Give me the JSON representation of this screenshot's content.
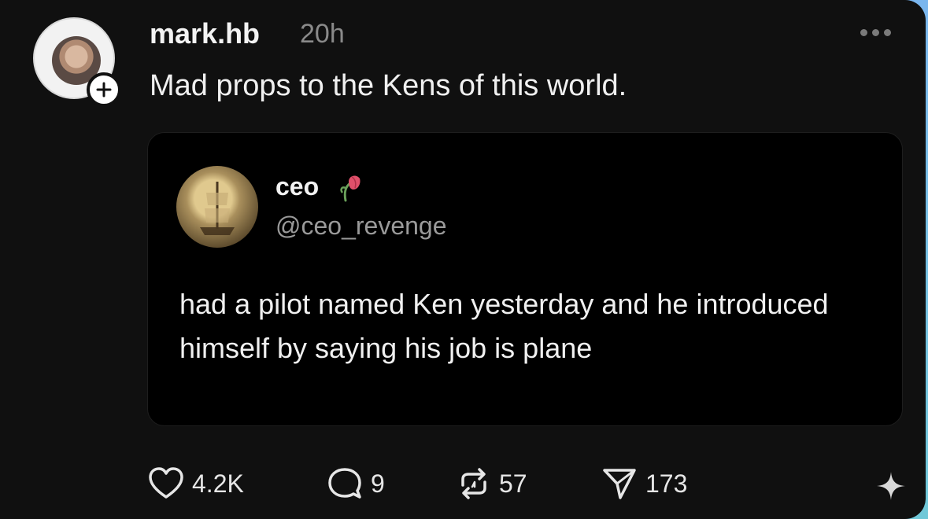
{
  "post": {
    "username": "mark.hb",
    "time": "20h",
    "text": "Mad props to the Kens of this world."
  },
  "quoted": {
    "name": "ceo",
    "handle": "@ceo_revenge",
    "body": "had a pilot named Ken yesterday and he introduced himself by saying his job is plane"
  },
  "actions": {
    "likes": "4.2K",
    "comments": "9",
    "reposts": "57",
    "shares": "173"
  },
  "icons": [
    "more-icon",
    "plus-icon",
    "flower-icon",
    "heart-icon",
    "comment-icon",
    "repost-icon",
    "share-icon",
    "sparkle-icon"
  ]
}
